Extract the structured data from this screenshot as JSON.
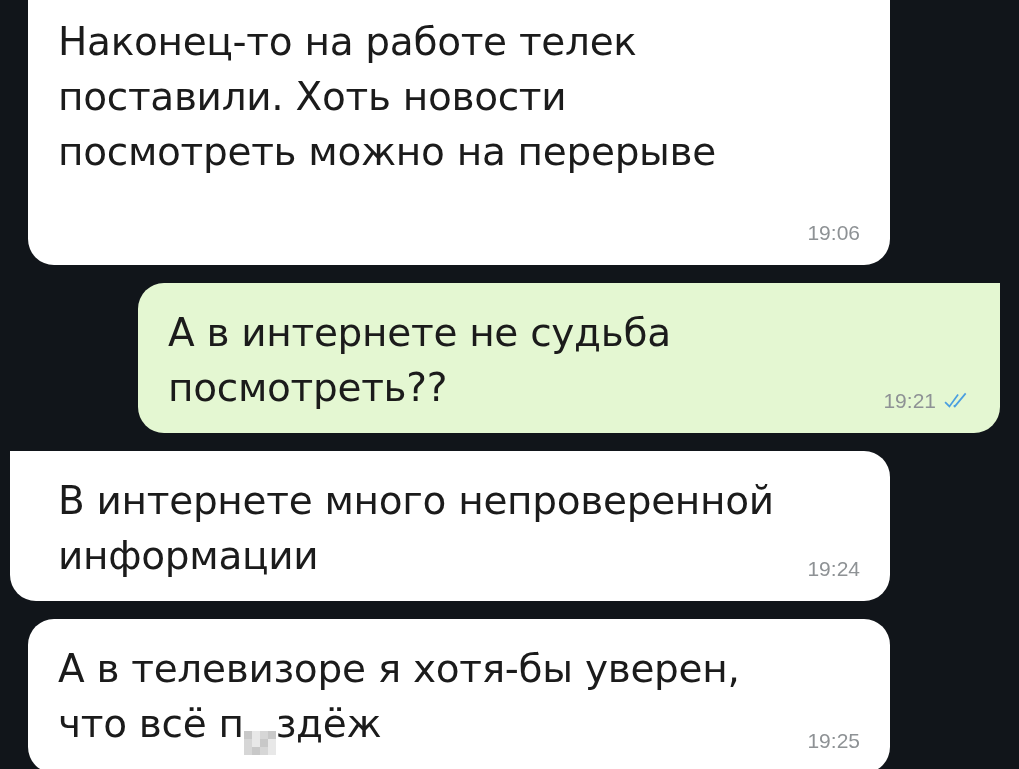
{
  "messages": [
    {
      "kind": "incoming",
      "tail": false,
      "lines": [
        "Наконец-то на работе телек",
        "поставили. Хоть новости",
        "посмотреть можно на перерыве"
      ],
      "time": "19:06"
    },
    {
      "kind": "outgoing",
      "tail": true,
      "lines": [
        "А в интернете не судьба",
        "посмотреть??"
      ],
      "time": "19:21",
      "read": true
    },
    {
      "kind": "incoming",
      "tail": true,
      "lines": [
        "В интернете много непроверенной",
        "информации"
      ],
      "time": "19:24"
    },
    {
      "kind": "incoming",
      "tail": false,
      "lines": [
        "А в телевизоре я хотя-бы уверен,",
        "что всё п"
      ],
      "censored": true,
      "after": "здёж",
      "time": "19:25"
    }
  ]
}
